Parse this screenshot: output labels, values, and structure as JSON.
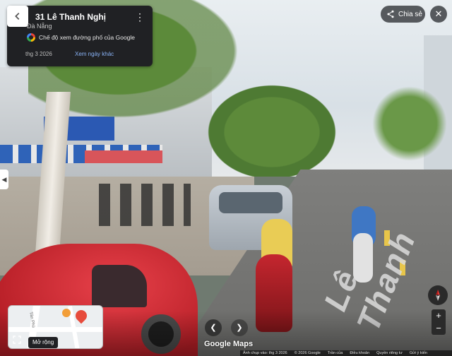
{
  "info_card": {
    "title": "31 Lê Thanh Nghị",
    "city": "Đà Nẵng",
    "mode_label": "Chế độ xem đường phố của Google",
    "date": "thg 3 2026",
    "see_more": "Xem ngày khác",
    "back_icon": "back-arrow-icon",
    "more_icon": "more-vert-icon"
  },
  "top_right": {
    "share_label": "Chia sẻ",
    "share_icon": "share-icon",
    "close_label": "✕"
  },
  "scene": {
    "road_text": "Lê Thanh"
  },
  "minimap": {
    "street_label": "Tân Phú",
    "expand_label": "Mở rộng"
  },
  "nav": {
    "left": "❮",
    "right": "❯",
    "logo": "Google Maps"
  },
  "controls": {
    "zoom_in": "+",
    "zoom_out": "−"
  },
  "footer": {
    "items": [
      "Ảnh chụp vào: thg 3 2026",
      "© 2026 Google",
      "Trần của",
      "Điều khoản",
      "Quyền riêng tư",
      "Gửi ý kiến"
    ]
  },
  "colors": {
    "card_bg": "#202124",
    "link": "#8ab4f8",
    "pin": "#e74c3c"
  }
}
